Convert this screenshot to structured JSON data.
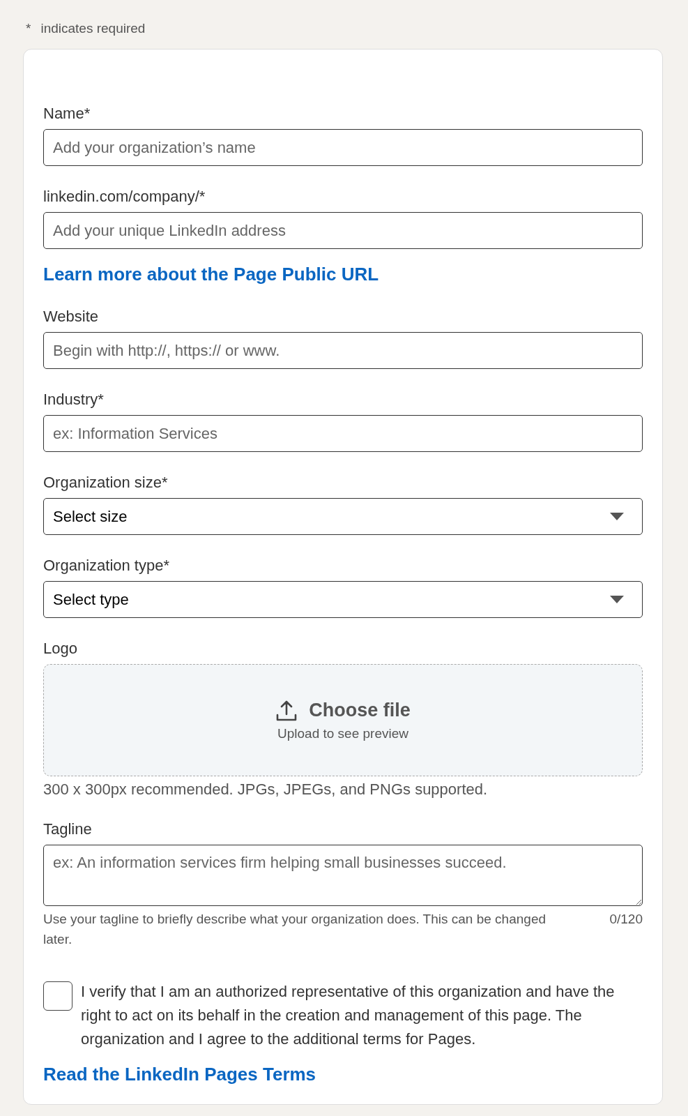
{
  "required_note": {
    "mark": "*",
    "text": "indicates required"
  },
  "fields": [
    {
      "kind": "text",
      "label": "Name*",
      "placeholder": "Add your organization’s name"
    },
    {
      "kind": "text",
      "label": "linkedin.com/company/*",
      "placeholder": "Add your unique LinkedIn address",
      "link": "Learn more about the Page Public URL"
    },
    {
      "kind": "text",
      "label": "Website",
      "placeholder": "Begin with http://, https:// or www."
    },
    {
      "kind": "text",
      "label": "Industry*",
      "placeholder": "ex: Information Services"
    },
    {
      "kind": "select",
      "label": "Organization size*",
      "value": "Select size"
    },
    {
      "kind": "select",
      "label": "Organization type*",
      "value": "Select type"
    },
    {
      "kind": "upload",
      "label": "Logo",
      "button": "Choose file",
      "subtext": "Upload to see preview",
      "hint": "300 x 300px recommended. JPGs, JPEGs, and PNGs supported."
    },
    {
      "kind": "textarea",
      "label": "Tagline",
      "placeholder": "ex: An information services firm helping small businesses succeed.",
      "hint": "Use your tagline to briefly describe what your organization does. This can be changed later.",
      "counter": "0/120"
    }
  ],
  "verification": {
    "checked": false,
    "text": "I verify that I am an authorized representative of this organization and have the right to act on its behalf in the creation and management of this page. The organization and I agree to the additional terms for Pages.",
    "link": "Read the LinkedIn Pages Terms"
  }
}
